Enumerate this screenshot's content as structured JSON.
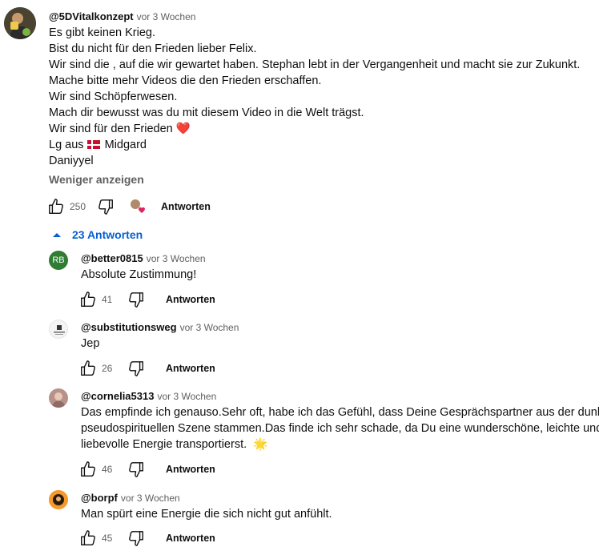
{
  "main_comment": {
    "author": "@5DVitalkonzept",
    "time": "vor 3 Wochen",
    "lines": [
      "Es gibt keinen Krieg.",
      "Bist du nicht für den Frieden lieber Felix.",
      "Wir sind die , auf die wir gewartet haben. Stephan lebt in der Vergangenheit und macht sie zur Zukunkt.",
      "Mache bitte mehr Videos die den Frieden erschaffen.",
      "Wir sind Schöpferwesen.",
      "Mach dir bewusst was du mit diesem Video in die Welt trägst.",
      "Wir sind für den Frieden",
      "Lg aus",
      "Midgard",
      "Daniyyel"
    ],
    "heart_emoji": "❤️",
    "show_less": "Weniger anzeigen",
    "likes": "250",
    "reply_label": "Antworten"
  },
  "replies_toggle": {
    "label": "23 Antworten"
  },
  "replies": [
    {
      "author": "@better0815",
      "time": "vor 3 Wochen",
      "avatar_text": "RB",
      "avatar_color": "#2e7d32",
      "lines": [
        "Absolute Zustimmung!"
      ],
      "likes": "41",
      "reply_label": "Antworten"
    },
    {
      "author": "@substitutionsweg",
      "time": "vor 3 Wochen",
      "lines": [
        "Jep"
      ],
      "likes": "26",
      "reply_label": "Antworten"
    },
    {
      "author": "@cornelia5313",
      "time": "vor 3 Wochen",
      "lines": [
        "Das empfinde ich genauso.Sehr oft, habe ich das Gefühl, dass Deine Gesprächspartner aus der dunklen,",
        "pseudospirituellen Szene stammen.Das finde ich sehr schade, da Du eine wunderschöne, leichte und",
        "liebevolle Energie  transportierst."
      ],
      "sun_emoji": "🌟",
      "likes": "46",
      "reply_label": "Antworten"
    },
    {
      "author": "@borpf",
      "time": "vor 3 Wochen",
      "lines": [
        "Man spürt eine Energie die sich nicht gut anfühlt."
      ],
      "likes": "45",
      "reply_label": "Antworten"
    }
  ],
  "colors": {
    "link_blue": "#065fd4",
    "secondary_text": "#606060",
    "heart_red": "#e0245e"
  }
}
